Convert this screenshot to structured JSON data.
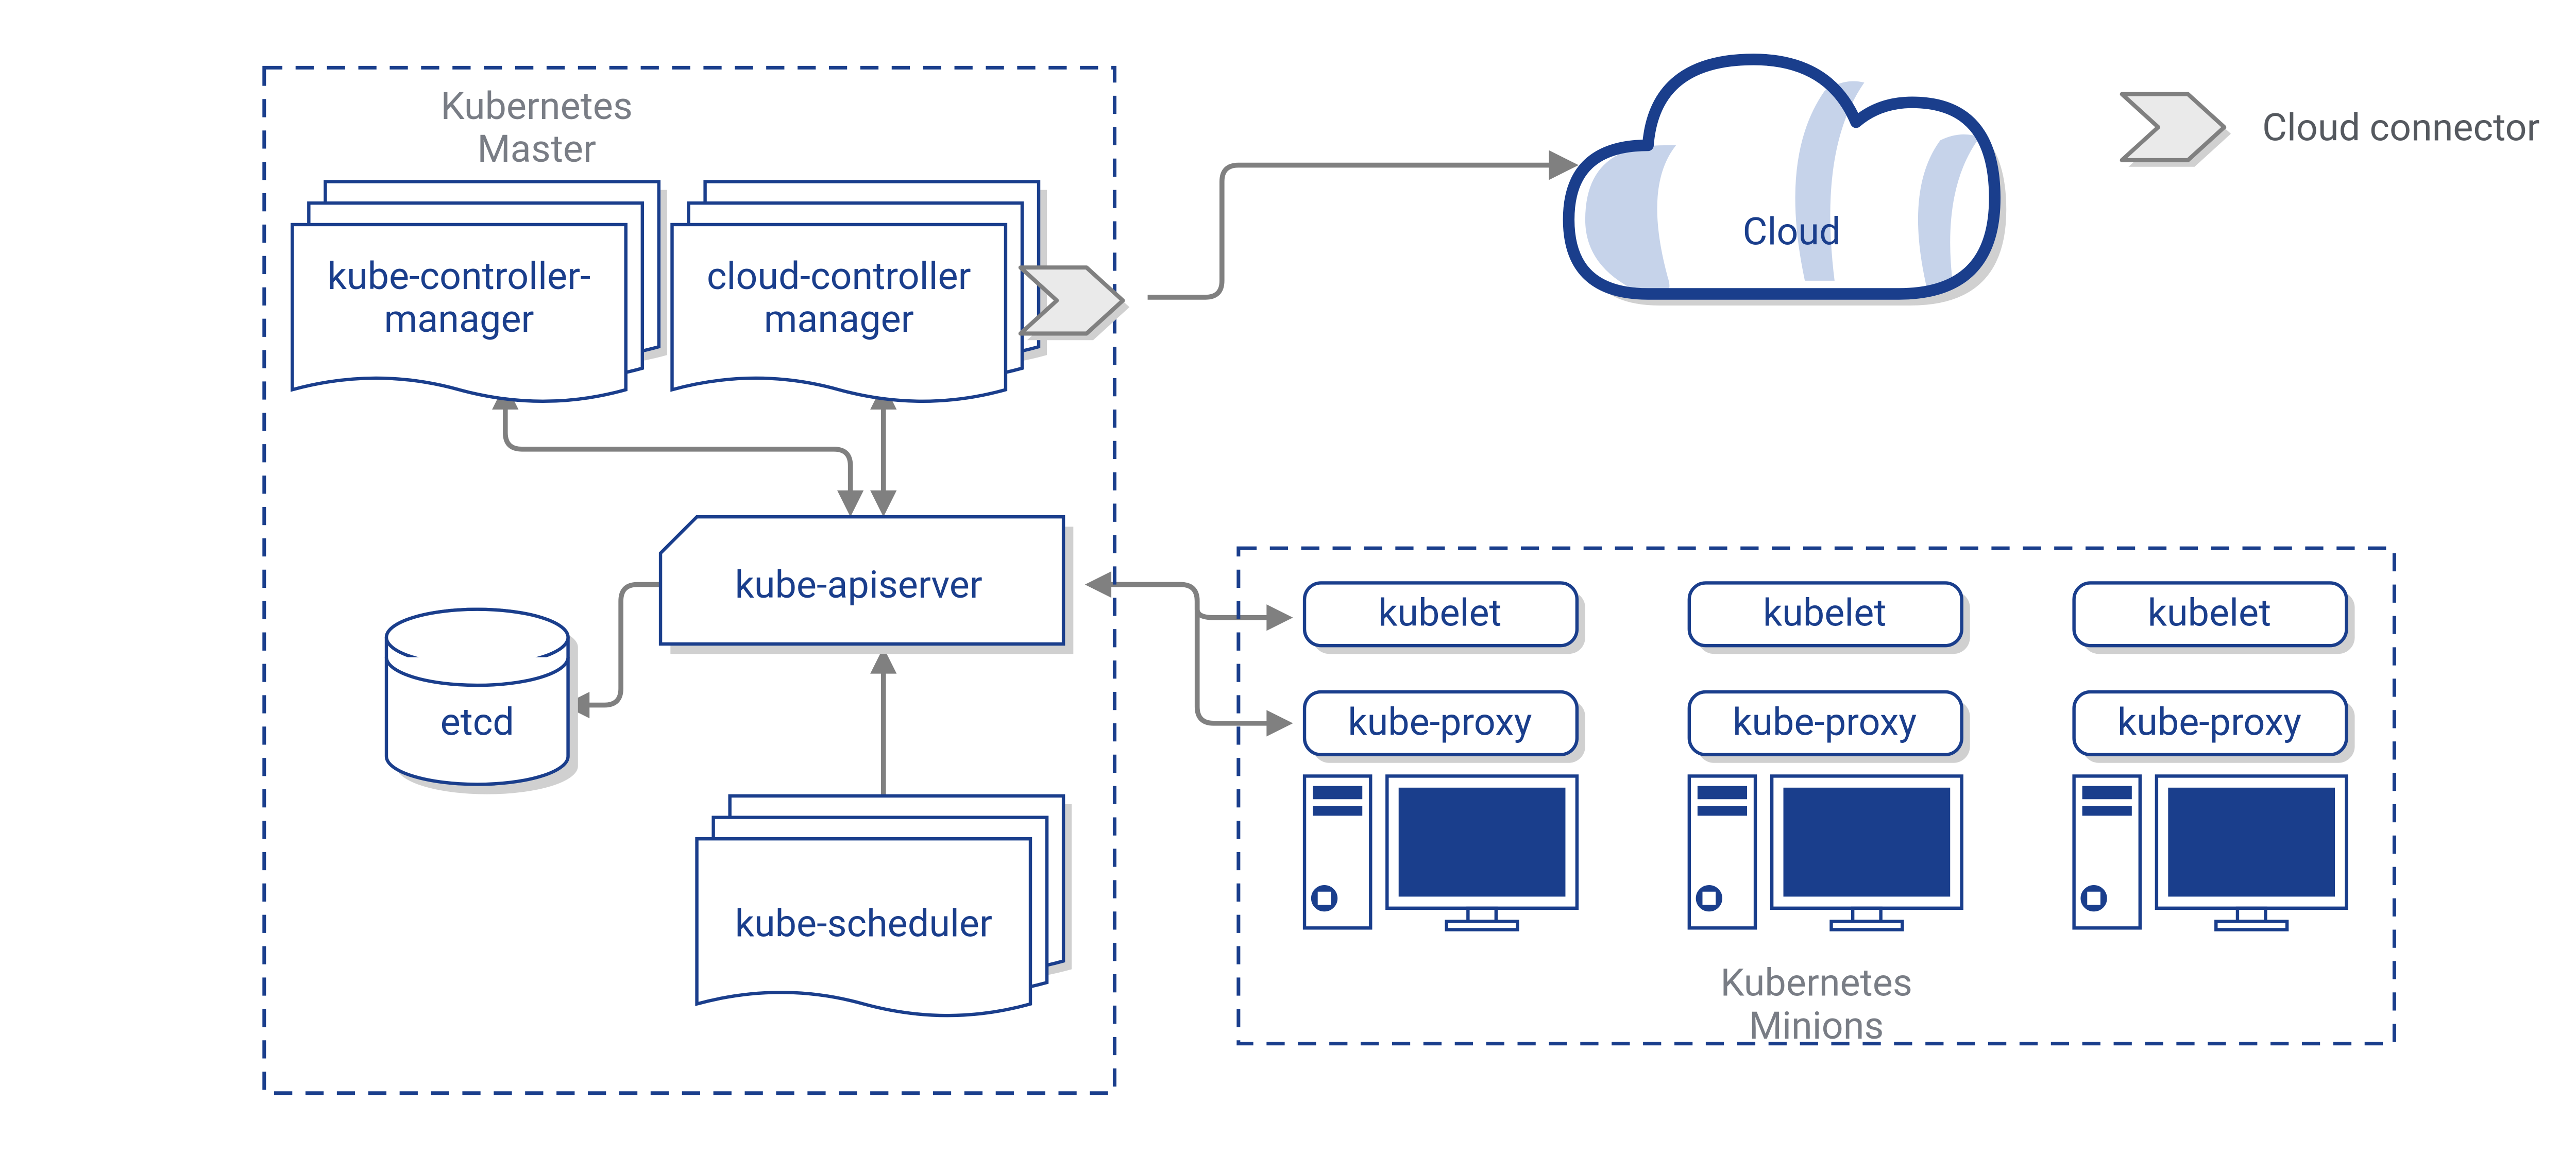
{
  "master": {
    "title_l1": "Kubernetes",
    "title_l2": "Master",
    "kube_controller_l1": "kube-controller-",
    "kube_controller_l2": "manager",
    "cloud_controller_l1": "cloud-controller",
    "cloud_controller_l2": "manager",
    "etcd": "etcd",
    "apiserver": "kube-apiserver",
    "scheduler": "kube-scheduler"
  },
  "minions": {
    "title_l1": "Kubernetes",
    "title_l2": "Minions",
    "kubelet": "kubelet",
    "kube_proxy": "kube-proxy"
  },
  "cloud": {
    "label": "Cloud"
  },
  "legend": {
    "connector": "Cloud connector"
  }
}
